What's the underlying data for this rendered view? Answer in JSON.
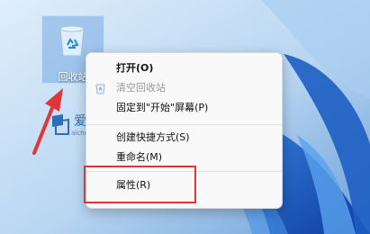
{
  "desktop": {
    "recycle_bin_label": "回收站"
  },
  "watermark": {
    "brand": "爱纯净",
    "url": "aichunjing.com"
  },
  "context_menu": {
    "items": [
      {
        "label": "打开(O)",
        "state": "default"
      },
      {
        "label": "清空回收站",
        "state": "disabled",
        "icon": "recycle-icon"
      },
      {
        "label": "固定到\"开始\"屏幕(P)",
        "state": "default"
      },
      {
        "label": "创建快捷方式(S)",
        "state": "default"
      },
      {
        "label": "重命名(M)",
        "state": "default"
      },
      {
        "label": "属性(R)",
        "state": "highlighted"
      }
    ]
  },
  "colors": {
    "highlight_border": "#e0363a",
    "arrow": "#e0363a",
    "wallpaper_accent": "#1f64c8"
  }
}
